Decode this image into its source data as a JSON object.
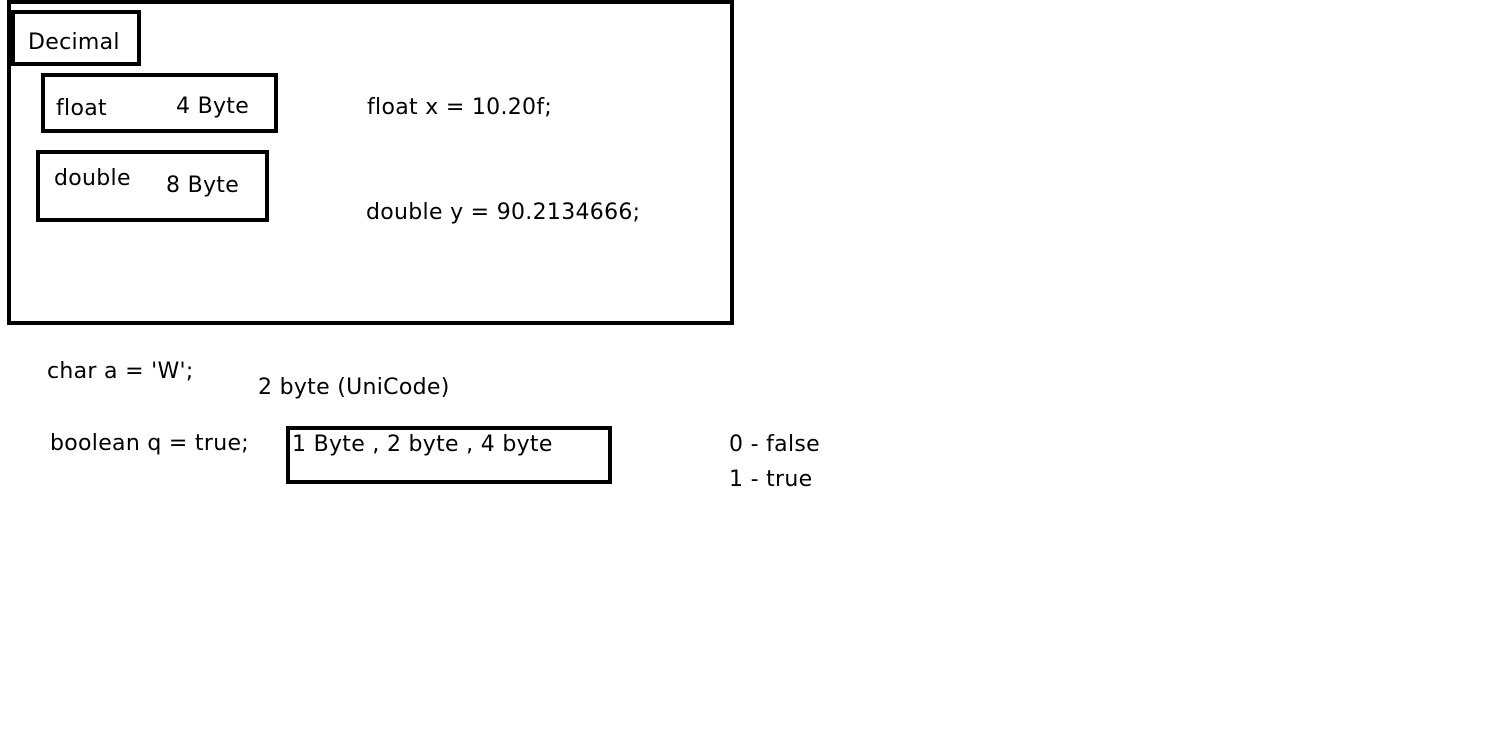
{
  "decimal_group": {
    "title": "Decimal",
    "float_type": {
      "name": "float",
      "size": "4 Byte"
    },
    "double_type": {
      "name": "double",
      "size": "8 Byte"
    },
    "float_example": "float x = 10.20f;",
    "double_example": "double y = 90.2134666;"
  },
  "char_section": {
    "example": "char a = 'W';",
    "size": "2 byte (UniCode)"
  },
  "boolean_section": {
    "example": "boolean q = true;",
    "sizes": "1 Byte , 2 byte , 4 byte",
    "values": [
      "0 - false",
      "1 - true"
    ]
  }
}
